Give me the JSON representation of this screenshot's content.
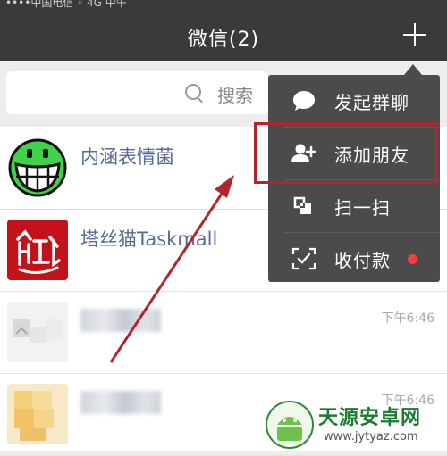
{
  "status_bar": {
    "text": "••••中国电信 ◦  4G        中午"
  },
  "nav": {
    "title": "微信(2)",
    "add_icon": "plus-icon"
  },
  "search": {
    "placeholder": "搜索"
  },
  "chats": [
    {
      "name": "内涵表情菌",
      "time": "",
      "avatar": "grin-face-avatar"
    },
    {
      "name": "塔丝猫Taskmall",
      "time": "",
      "avatar": "taskmall-logo-avatar"
    },
    {
      "name": "",
      "time": "下午6:46",
      "avatar": "blurred-avatar"
    },
    {
      "name": "",
      "time": "下午6:46",
      "avatar": "blurred-avatar"
    }
  ],
  "menu": {
    "items": [
      {
        "label": "发起群聊",
        "icon": "chat-bubble-icon"
      },
      {
        "label": "添加朋友",
        "icon": "add-friend-icon"
      },
      {
        "label": "扫一扫",
        "icon": "scan-icon"
      },
      {
        "label": "收付款",
        "icon": "payment-scan-icon",
        "badge": true
      }
    ]
  },
  "colors": {
    "header": "#3a3a3c",
    "menu": "#4b4b4d",
    "highlight": "#b0262a",
    "badge": "#fa3e3e",
    "chat_name": "#576b95"
  },
  "watermark": {
    "title": "天源安卓网",
    "url": "www.jytyaz.com"
  }
}
